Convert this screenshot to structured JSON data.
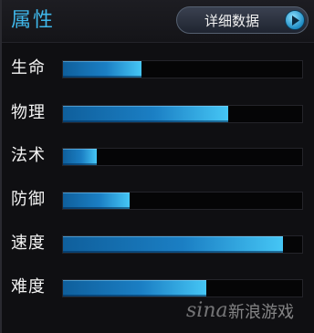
{
  "header": {
    "title": "属性",
    "detail_button": "详细数据"
  },
  "stats": [
    {
      "label": "生命",
      "level": 0.33
    },
    {
      "label": "物理",
      "level": 0.69
    },
    {
      "label": "法术",
      "level": 0.14
    },
    {
      "label": "防御",
      "level": 0.28
    },
    {
      "label": "速度",
      "level": 0.92
    },
    {
      "label": "难度",
      "level": 0.6
    }
  ],
  "watermark": {
    "logo": "sina",
    "text": "新浪游戏"
  },
  "colors": {
    "title": "#3fb7ea",
    "bar_fill_start": "#0f5f9c",
    "bar_fill_end": "#45c6f5",
    "background": "#0f0f12"
  }
}
